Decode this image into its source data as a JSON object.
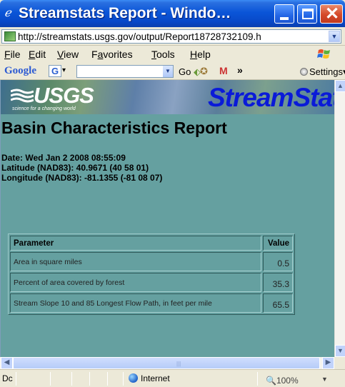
{
  "window": {
    "title": "Streamstats Report - Windo…",
    "title_icon": "ie-icon"
  },
  "address": {
    "url": "http://streamstats.usgs.gov/output/Report18728732109.h"
  },
  "menu": {
    "items": [
      {
        "label": "File",
        "key": "F",
        "rest": "ile"
      },
      {
        "label": "Edit",
        "key": "E",
        "rest": "dit"
      },
      {
        "label": "View",
        "key": "V",
        "rest": "iew"
      },
      {
        "label": "Favorites",
        "key": "a",
        "pre": "F",
        "rest": "vorites"
      },
      {
        "label": "Tools",
        "key": "T",
        "rest": "ools"
      },
      {
        "label": "Help",
        "key": "H",
        "rest": "elp"
      }
    ]
  },
  "google_toolbar": {
    "logo": "Google",
    "g_button": "G",
    "go_label": "Go",
    "more": "»",
    "settings": "Settings"
  },
  "page": {
    "usgs_logo": "USGS",
    "usgs_tagline": "science for a changing world",
    "streamstats_logo": "StreamStats",
    "report_title": "Basin Characteristics Report",
    "date": "Date: Wed Jan 2 2008 08:55:09",
    "latitude": "Latitude (NAD83): 40.9671 (40 58 01)",
    "longitude": "Longitude (NAD83): -81.1355 (-81 08 07)",
    "table": {
      "headers": [
        "Parameter",
        "Value"
      ],
      "rows": [
        {
          "parameter": "Area in square miles",
          "value": "0.5"
        },
        {
          "parameter": "Percent of area covered by forest",
          "value": "35.3"
        },
        {
          "parameter": "Stream Slope 10 and 85 Longest Flow Path, in feet per mile",
          "value": "65.5"
        }
      ]
    }
  },
  "status": {
    "text": "Dc",
    "zone": "Internet",
    "zoom": "100%"
  },
  "colors": {
    "page_background": "#65A0A0",
    "title_bar": "#0A55D8",
    "streamstats_logo": "#0A1AD8"
  }
}
